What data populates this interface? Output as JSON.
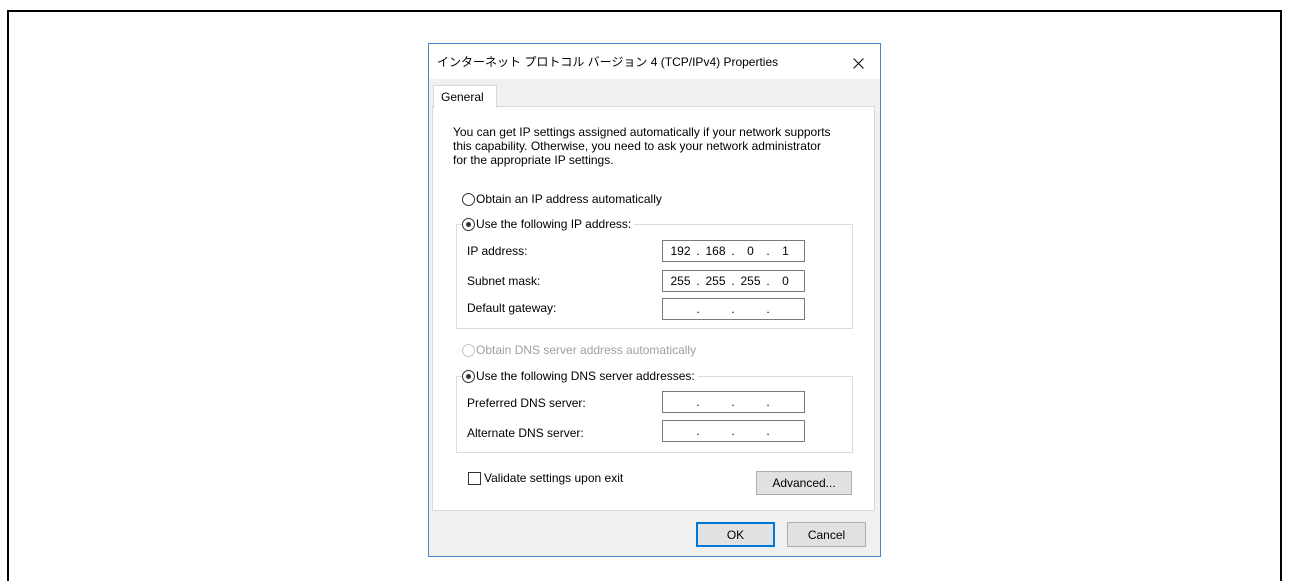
{
  "window": {
    "title": "インターネット プロトコル バージョン 4 (TCP/IPv4) Properties",
    "close_icon": "close-icon"
  },
  "tabs": [
    {
      "label": "General",
      "selected": true
    }
  ],
  "general": {
    "description_lines": [
      "You can get IP settings assigned automatically if your network supports",
      "this capability. Otherwise, you need to ask your network administrator",
      "for the appropriate IP settings."
    ],
    "octet_separator": ".",
    "ip": {
      "auto": {
        "label": "Obtain an IP address automatically",
        "selected": false,
        "enabled": true
      },
      "manual": {
        "label": "Use the following IP address:",
        "selected": true,
        "enabled": true
      },
      "fields": [
        {
          "label": "IP address:",
          "octets": [
            "192",
            "168",
            "0",
            "1"
          ]
        },
        {
          "label": "Subnet mask:",
          "octets": [
            "255",
            "255",
            "255",
            "0"
          ]
        },
        {
          "label": "Default gateway:",
          "octets": [
            "",
            "",
            "",
            ""
          ]
        }
      ]
    },
    "dns": {
      "auto": {
        "label": "Obtain DNS server address automatically",
        "selected": false,
        "enabled": false
      },
      "manual": {
        "label": "Use the following DNS server addresses:",
        "selected": true,
        "enabled": true
      },
      "fields": [
        {
          "label": "Preferred DNS server:",
          "octets": [
            "",
            "",
            "",
            ""
          ]
        },
        {
          "label": "Alternate DNS server:",
          "octets": [
            "",
            "",
            "",
            ""
          ]
        }
      ]
    },
    "validate_on_exit": {
      "label": "Validate settings upon exit",
      "checked": false
    },
    "advanced_button": "Advanced..."
  },
  "footer": {
    "ok_label": "OK",
    "cancel_label": "Cancel",
    "ok_is_default": true
  },
  "colors": {
    "accent": "#0078d7",
    "window_border": "#4a86c5",
    "dialog_background": "#f0f0f0",
    "panel_background": "#ffffff",
    "disabled_text": "#a0a0a0"
  }
}
